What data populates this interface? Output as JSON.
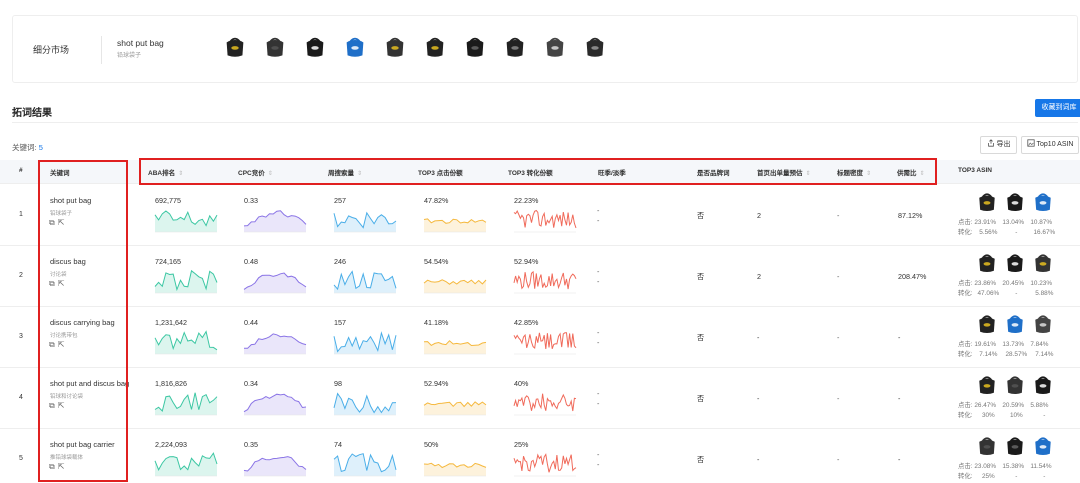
{
  "market": {
    "label": "细分市场",
    "name": "shot put bag",
    "name_sub": "铅球袋子",
    "thumb_count": 10
  },
  "section": {
    "title": "拓词结果",
    "save_label": "收藏到词库"
  },
  "toolbar": {
    "kw_count_label": "关键词:",
    "kw_count_value": "5",
    "export_label": "导出",
    "top10_label": "Top10 ASIN"
  },
  "columns": {
    "idx": "#",
    "keyword": "关键词",
    "aba": "ABA排名",
    "cpc": "CPC竞价",
    "search": "周搜索量",
    "top3_click": "TOP3 点击份额",
    "top3_conv": "TOP3 转化份额",
    "season": "旺季/淡季",
    "brand": "是否品牌词",
    "first_page": "首页出单量预估",
    "title_density": "标题密度",
    "supply": "供需比",
    "top3_asin": "TOP3 ASIN"
  },
  "asin_labels": {
    "click": "点击:",
    "conv": "转化:"
  },
  "rows": [
    {
      "idx": "1",
      "keyword": "shot put bag",
      "sub": "铅球袋子",
      "aba": "692,775",
      "cpc": "0.33",
      "search": "257",
      "click": "47.82%",
      "conv": "22.23%",
      "season_a": "-",
      "season_b": "-",
      "brand": "否",
      "first_page": "2",
      "title_density": "-",
      "supply": "87.12%",
      "asin_click": [
        "23.91%",
        "13.04%",
        "10.87%"
      ],
      "asin_conv": [
        "5.56%",
        "-",
        "16.67%"
      ]
    },
    {
      "idx": "2",
      "keyword": "discus bag",
      "sub": "讨论袋",
      "aba": "724,165",
      "cpc": "0.48",
      "search": "246",
      "click": "54.54%",
      "conv": "52.94%",
      "season_a": "-",
      "season_b": "-",
      "brand": "否",
      "first_page": "2",
      "title_density": "-",
      "supply": "208.47%",
      "asin_click": [
        "23.86%",
        "20.45%",
        "10.23%"
      ],
      "asin_conv": [
        "47.06%",
        "-",
        "5.88%"
      ]
    },
    {
      "idx": "3",
      "keyword": "discus carrying bag",
      "sub": "讨论携带包",
      "aba": "1,231,642",
      "cpc": "0.44",
      "search": "157",
      "click": "41.18%",
      "conv": "42.85%",
      "season_a": "-",
      "season_b": "-",
      "brand": "否",
      "first_page": "-",
      "title_density": "-",
      "supply": "-",
      "asin_click": [
        "19.61%",
        "13.73%",
        "7.84%"
      ],
      "asin_conv": [
        "7.14%",
        "28.57%",
        "7.14%"
      ]
    },
    {
      "idx": "4",
      "keyword": "shot put and discus bag",
      "sub": "铅球和讨论袋",
      "aba": "1,816,826",
      "cpc": "0.34",
      "search": "98",
      "click": "52.94%",
      "conv": "40%",
      "season_a": "-",
      "season_b": "-",
      "brand": "否",
      "first_page": "-",
      "title_density": "-",
      "supply": "-",
      "asin_click": [
        "26.47%",
        "20.59%",
        "5.88%"
      ],
      "asin_conv": [
        "30%",
        "10%",
        "-"
      ]
    },
    {
      "idx": "5",
      "keyword": "shot put bag carrier",
      "sub": "推铅球袋载体",
      "aba": "2,224,093",
      "cpc": "0.35",
      "search": "74",
      "click": "50%",
      "conv": "25%",
      "season_a": "-",
      "season_b": "-",
      "brand": "否",
      "first_page": "-",
      "title_density": "-",
      "supply": "-",
      "asin_click": [
        "23.08%",
        "15.38%",
        "11.54%"
      ],
      "asin_conv": [
        "25%",
        "-",
        "-"
      ]
    }
  ],
  "colors": {
    "accent": "#1677e8",
    "highlight": "#e02020",
    "aba": "#3cc7a3",
    "cpc": "#8a74e6",
    "search": "#4aaee8",
    "click": "#f5b83d",
    "conv": "#f06a5a"
  },
  "icons": [
    "copy-icon",
    "share-icon",
    "export-icon",
    "image-icon",
    "sort-icon"
  ]
}
